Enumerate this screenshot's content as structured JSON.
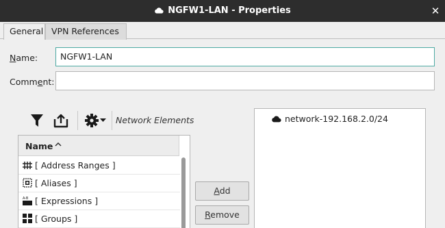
{
  "window": {
    "title": "NGFW1-LAN - Properties",
    "close_glyph": "✕",
    "title_icon": "cloud-icon"
  },
  "tabs": [
    {
      "label": "General",
      "active": true
    },
    {
      "label": "VPN References",
      "active": false
    }
  ],
  "form": {
    "name_label_first": "N",
    "name_label_rest": "ame:",
    "name_value": "NGFW1-LAN",
    "comment_label_pre": "Comm",
    "comment_label_ul": "e",
    "comment_label_post": "nt:",
    "comment_value": ""
  },
  "toolbar": {
    "label": "Network Elements",
    "icons": [
      "filter-icon",
      "export-icon",
      "gear-icon"
    ]
  },
  "list": {
    "header": "Name",
    "sort": "ascending",
    "items": [
      {
        "label": "[ Address Ranges ]",
        "icon": "address-range-icon"
      },
      {
        "label": "[ Aliases ]",
        "icon": "alias-icon"
      },
      {
        "label": "[ Expressions ]",
        "icon": "expression-icon"
      },
      {
        "label": "[ Groups ]",
        "icon": "group-icon"
      }
    ]
  },
  "buttons": {
    "add_ul": "A",
    "add_rest": "dd",
    "remove_ul": "R",
    "remove_rest": "emove"
  },
  "selected": {
    "items": [
      {
        "label": "network-192.168.2.0/24",
        "icon": "cloud-icon"
      }
    ]
  },
  "colors": {
    "titlebar": "#2d2d2d",
    "focus_border": "#4ca9a2"
  }
}
